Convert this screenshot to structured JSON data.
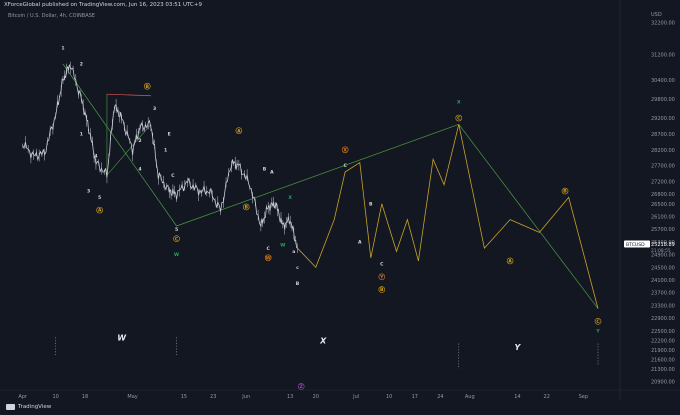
{
  "header": {
    "publisher": "XForceGlobal published on TradingView.com, Jun 16, 2023 03:51 UTC+9",
    "symbol": "Bitcoin / U.S. Dollar, 4h, COINBASE"
  },
  "footer": {
    "brand": "TradingView"
  },
  "colors": {
    "background": "#131722",
    "price": "#c8ccd6",
    "projection": "#c9a227",
    "trendline": "#4c9a44",
    "triangle": "#e0555a",
    "circled_yellow": "#d4a017",
    "circled_orange": "#e07b1a",
    "circled_purple": "#a34bbf",
    "wave_white": "#d1d4dc",
    "wave_green": "#26a65b",
    "price_tag": "#ffffff"
  },
  "chart_data": {
    "type": "line",
    "currency_label": "USD",
    "y_ticks": [
      "32200.00",
      "31200.00",
      "30400.00",
      "29800.00",
      "29200.00",
      "28700.00",
      "28200.00",
      "27700.00",
      "27200.00",
      "26800.00",
      "26500.00",
      "26100.00",
      "25700.00",
      "25300.00",
      "24900.00",
      "24500.00",
      "24100.00",
      "23700.00",
      "23300.00",
      "22900.00",
      "22500.00",
      "22200.00",
      "21900.00",
      "21600.00",
      "21300.00",
      "20900.00"
    ],
    "x_ticks": [
      "Apr",
      "10",
      "18",
      "May",
      "15",
      "23",
      "Jun",
      "13",
      "20",
      "Jul",
      "10",
      "17",
      "24",
      "Aug",
      "14",
      "22",
      "Sep"
    ],
    "last_price": "25218.89",
    "last_price_countdown": "21:08:55",
    "price_series": {
      "name": "BTCUSD",
      "x": [
        "2023-04-01",
        "2023-04-04",
        "2023-04-07",
        "2023-04-10",
        "2023-04-12",
        "2023-04-14",
        "2023-04-17",
        "2023-04-19",
        "2023-04-21",
        "2023-04-24",
        "2023-04-26",
        "2023-04-28",
        "2023-05-01",
        "2023-05-03",
        "2023-05-06",
        "2023-05-08",
        "2023-05-11",
        "2023-05-13",
        "2023-05-16",
        "2023-05-19",
        "2023-05-22",
        "2023-05-25",
        "2023-05-28",
        "2023-05-30",
        "2023-06-02",
        "2023-06-05",
        "2023-06-07",
        "2023-06-09",
        "2023-06-11",
        "2023-06-13",
        "2023-06-15"
      ],
      "y": [
        28400,
        28000,
        28100,
        29300,
        30400,
        30900,
        29800,
        28900,
        27800,
        27400,
        29600,
        29200,
        28200,
        28900,
        29000,
        27400,
        26900,
        26800,
        27200,
        26900,
        26900,
        26300,
        27800,
        27700,
        27100,
        25800,
        26400,
        26500,
        25800,
        26000,
        25100
      ]
    },
    "projection": {
      "name": "Projection",
      "x": [
        "2023-06-15",
        "2023-06-20",
        "2023-06-25",
        "2023-06-28",
        "2023-07-02",
        "2023-07-05",
        "2023-07-08",
        "2023-07-12",
        "2023-07-15",
        "2023-07-18",
        "2023-07-22",
        "2023-07-25",
        "2023-07-29",
        "2023-08-05",
        "2023-08-12",
        "2023-08-20",
        "2023-08-28",
        "2023-09-05"
      ],
      "y": [
        25100,
        24500,
        26000,
        27500,
        27800,
        24800,
        26500,
        25000,
        26000,
        24700,
        27900,
        27100,
        29000,
        25100,
        26000,
        25600,
        26700,
        23200
      ]
    },
    "trendlines": [
      {
        "name": "lower-channel",
        "from": [
          "2023-04-12",
          30900
        ],
        "to": [
          "2023-05-13",
          25800
        ]
      },
      {
        "name": "lower-channel-2",
        "from": [
          "2023-05-13",
          25800
        ],
        "to": [
          "2023-07-29",
          29000
        ]
      },
      {
        "name": "upper-channel-down",
        "from": [
          "2023-07-29",
          29000
        ],
        "to": [
          "2023-09-05",
          23200
        ]
      }
    ],
    "wave_labels": [
      {
        "text": "1",
        "style": "white",
        "at": [
          "2023-04-12",
          31400
        ]
      },
      {
        "text": "2",
        "style": "white",
        "at": [
          "2023-04-17",
          30900
        ]
      },
      {
        "text": "1",
        "style": "white",
        "at": [
          "2023-04-17",
          28700
        ]
      },
      {
        "text": "4",
        "style": "white",
        "at": [
          "2023-04-21",
          28000
        ]
      },
      {
        "text": "3",
        "style": "white",
        "at": [
          "2023-04-19",
          26900
        ]
      },
      {
        "text": "5",
        "style": "white",
        "at": [
          "2023-04-22",
          26700
        ]
      },
      {
        "text": "A",
        "style": "circled_yellow",
        "at": [
          "2023-04-22",
          26300
        ]
      },
      {
        "text": "B",
        "style": "circled_yellow",
        "at": [
          "2023-05-05",
          30200
        ]
      },
      {
        "text": "3",
        "style": "white",
        "at": [
          "2023-05-07",
          29500
        ]
      },
      {
        "text": "2",
        "style": "white",
        "at": [
          "2023-05-03",
          28500
        ]
      },
      {
        "text": "4",
        "style": "white",
        "at": [
          "2023-05-03",
          27600
        ]
      },
      {
        "text": "1",
        "style": "white",
        "at": [
          "2023-05-10",
          28200
        ]
      },
      {
        "text": "E",
        "style": "white",
        "at": [
          "2023-05-11",
          28700
        ]
      },
      {
        "text": "C",
        "style": "white",
        "at": [
          "2023-05-12",
          27400
        ]
      },
      {
        "text": "5",
        "style": "white",
        "at": [
          "2023-05-13",
          25700
        ]
      },
      {
        "text": "C",
        "style": "circled_yellow",
        "at": [
          "2023-05-13",
          25400
        ]
      },
      {
        "text": "W",
        "style": "green",
        "at": [
          "2023-05-13",
          24900
        ]
      },
      {
        "text": "A",
        "style": "circled_yellow",
        "at": [
          "2023-05-30",
          28800
        ]
      },
      {
        "text": "B",
        "style": "white",
        "at": [
          "2023-06-06",
          27600
        ]
      },
      {
        "text": "A",
        "style": "white",
        "at": [
          "2023-06-08",
          27500
        ]
      },
      {
        "text": "B",
        "style": "circled_yellow",
        "at": [
          "2023-06-01",
          26400
        ]
      },
      {
        "text": "X",
        "style": "green",
        "at": [
          "2023-06-13",
          26700
        ]
      },
      {
        "text": "C",
        "style": "white",
        "at": [
          "2023-06-07",
          25100
        ]
      },
      {
        "text": "W",
        "style": "circled_orange",
        "at": [
          "2023-06-07",
          24800
        ]
      },
      {
        "text": "W",
        "style": "green",
        "at": [
          "2023-06-11",
          25200
        ]
      },
      {
        "text": "a",
        "style": "white",
        "at": [
          "2023-06-14",
          25000
        ]
      },
      {
        "text": "c",
        "style": "white",
        "at": [
          "2023-06-15",
          24500
        ]
      },
      {
        "text": "B",
        "style": "white",
        "at": [
          "2023-06-15",
          24000
        ]
      },
      {
        "text": "X",
        "style": "circled_orange",
        "at": [
          "2023-06-28",
          28200
        ]
      },
      {
        "text": "C",
        "style": "white",
        "at": [
          "2023-06-28",
          27700
        ]
      },
      {
        "text": "B",
        "style": "white",
        "at": [
          "2023-07-05",
          26500
        ]
      },
      {
        "text": "A",
        "style": "white",
        "at": [
          "2023-07-02",
          25300
        ]
      },
      {
        "text": "C",
        "style": "white",
        "at": [
          "2023-07-08",
          24600
        ]
      },
      {
        "text": "Y",
        "style": "circled_orange",
        "at": [
          "2023-07-08",
          24200
        ]
      },
      {
        "text": "B",
        "style": "circled_yellow",
        "at": [
          "2023-07-08",
          23800
        ]
      },
      {
        "text": "X",
        "style": "green",
        "at": [
          "2023-07-29",
          29700
        ]
      },
      {
        "text": "C",
        "style": "circled_yellow",
        "at": [
          "2023-07-29",
          29200
        ]
      },
      {
        "text": "A",
        "style": "circled_yellow",
        "at": [
          "2023-08-12",
          24700
        ]
      },
      {
        "text": "B",
        "style": "circled_yellow",
        "at": [
          "2023-08-27",
          26900
        ]
      },
      {
        "text": "C",
        "style": "circled_yellow",
        "at": [
          "2023-09-05",
          22800
        ]
      },
      {
        "text": "Y",
        "style": "green",
        "at": [
          "2023-09-05",
          22500
        ]
      },
      {
        "text": "Z",
        "style": "circled_purple",
        "at": [
          "2023-06-16",
          20750
        ]
      }
    ],
    "big_labels": [
      {
        "text": "W",
        "at": [
          "2023-04-28",
          22200
        ]
      },
      {
        "text": "X",
        "at": [
          "2023-06-22",
          22100
        ]
      },
      {
        "text": "Y",
        "at": [
          "2023-08-14",
          21900
        ]
      }
    ]
  }
}
